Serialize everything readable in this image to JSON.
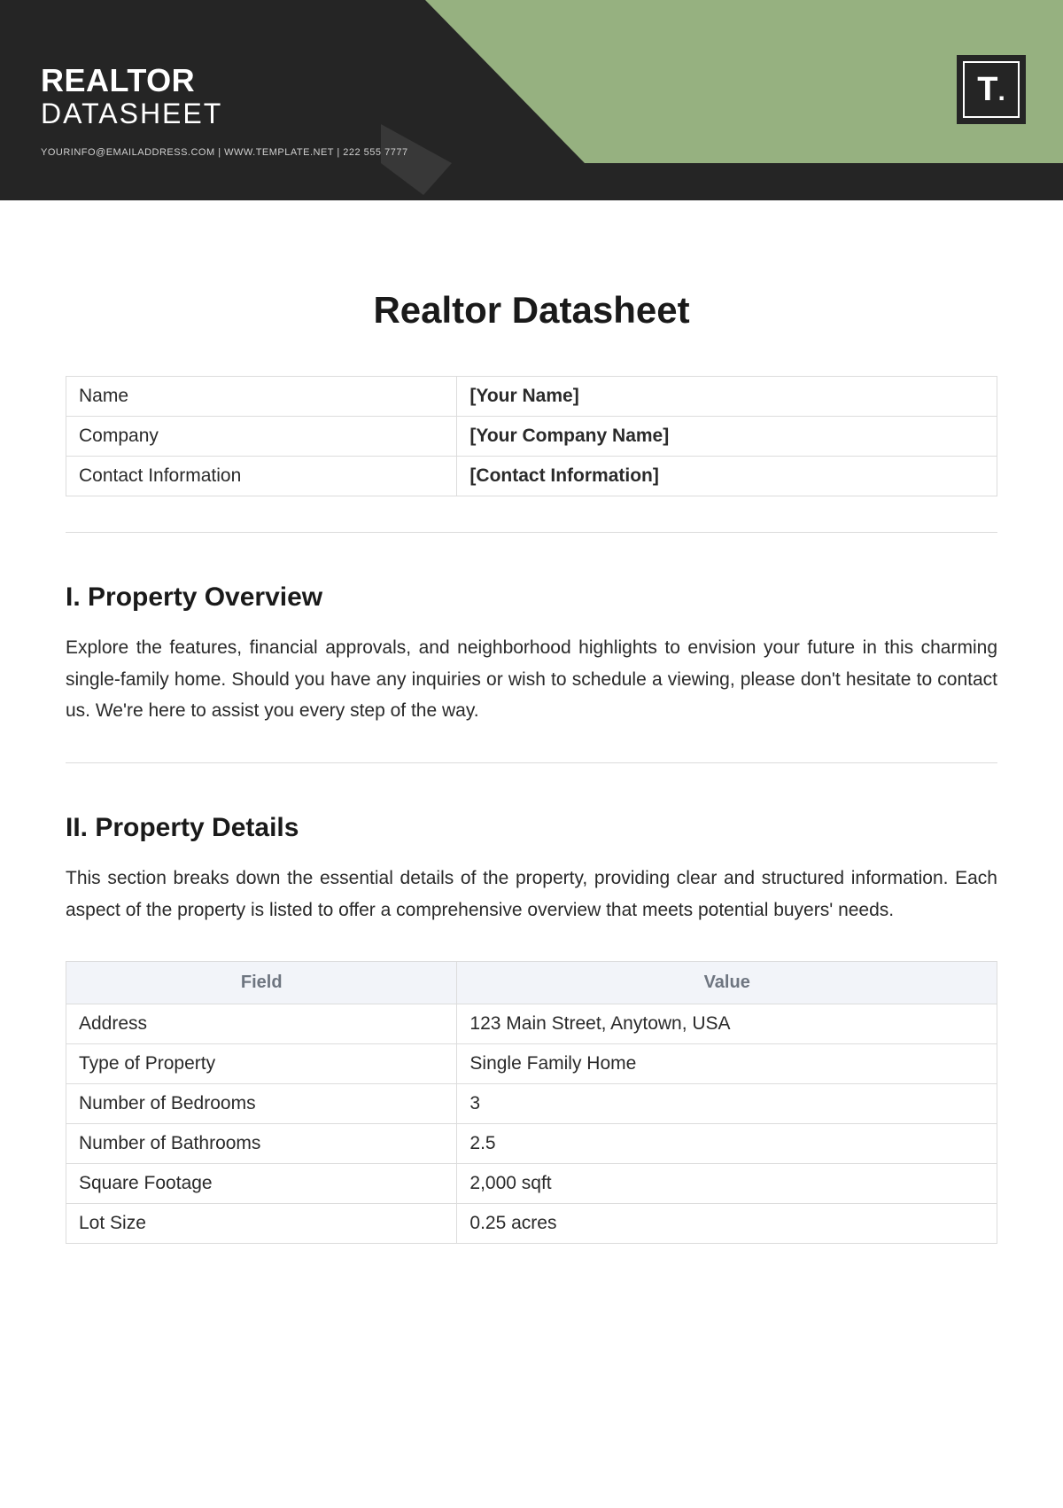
{
  "header": {
    "title_line1": "REALTOR",
    "title_line2": "DATASHEET",
    "contact_line": "YOURINFO@EMAILADDRESS.COM | WWW.TEMPLATE.NET | 222 555 7777",
    "logo_text": "T",
    "logo_dot": "."
  },
  "doc_title": "Realtor Datasheet",
  "info_rows": [
    {
      "label": "Name",
      "value": "[Your Name]"
    },
    {
      "label": "Company",
      "value": "[Your Company Name]"
    },
    {
      "label": "Contact Information",
      "value": "[Contact Information]"
    }
  ],
  "section1": {
    "heading": "I. Property Overview",
    "body": "Explore the features, financial approvals, and neighborhood highlights to envision your future in this charming single-family home. Should you have any inquiries or wish to schedule a viewing, please don't hesitate to contact us. We're here to assist you every step of the way."
  },
  "section2": {
    "heading": "II. Property Details",
    "body": "This section breaks down the essential details of the property, providing clear and structured information. Each aspect of the property is listed to offer a comprehensive overview that meets potential buyers' needs.",
    "columns": {
      "field": "Field",
      "value": "Value"
    },
    "rows": [
      {
        "label": "Address",
        "value": "123 Main Street, Anytown, USA"
      },
      {
        "label": "Type of Property",
        "value": "Single Family Home"
      },
      {
        "label": "Number of Bedrooms",
        "value": "3"
      },
      {
        "label": "Number of Bathrooms",
        "value": "2.5"
      },
      {
        "label": "Square Footage",
        "value": "2,000 sqft"
      },
      {
        "label": "Lot Size",
        "value": "0.25 acres"
      }
    ]
  }
}
